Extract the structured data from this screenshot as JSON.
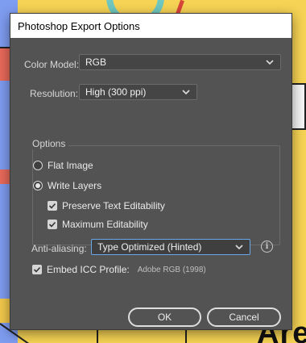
{
  "dialog": {
    "title": "Photoshop Export Options",
    "color_model": {
      "label": "Color Model:",
      "value": "RGB"
    },
    "resolution": {
      "label": "Resolution:",
      "value": "High (300 ppi)"
    },
    "options": {
      "title": "Options",
      "flat_image": {
        "label": "Flat Image",
        "selected": false
      },
      "write_layers": {
        "label": "Write Layers",
        "selected": true
      },
      "preserve_text": {
        "label": "Preserve Text Editability",
        "checked": true
      },
      "max_editability": {
        "label": "Maximum Editability",
        "checked": true
      }
    },
    "anti_aliasing": {
      "label": "Anti-aliasing:",
      "value": "Type Optimized (Hinted)"
    },
    "embed_icc": {
      "label": "Embed ICC Profile:",
      "checked": true,
      "profile": "Adobe RGB (1998)"
    },
    "ok_label": "OK",
    "cancel_label": "Cancel"
  },
  "icons": {
    "info": "i"
  },
  "background": {
    "text": "Are"
  },
  "colors": {
    "dialog_bg": "#535353",
    "focus_border": "#68a7e8",
    "background_yellow": "#f6d354"
  }
}
